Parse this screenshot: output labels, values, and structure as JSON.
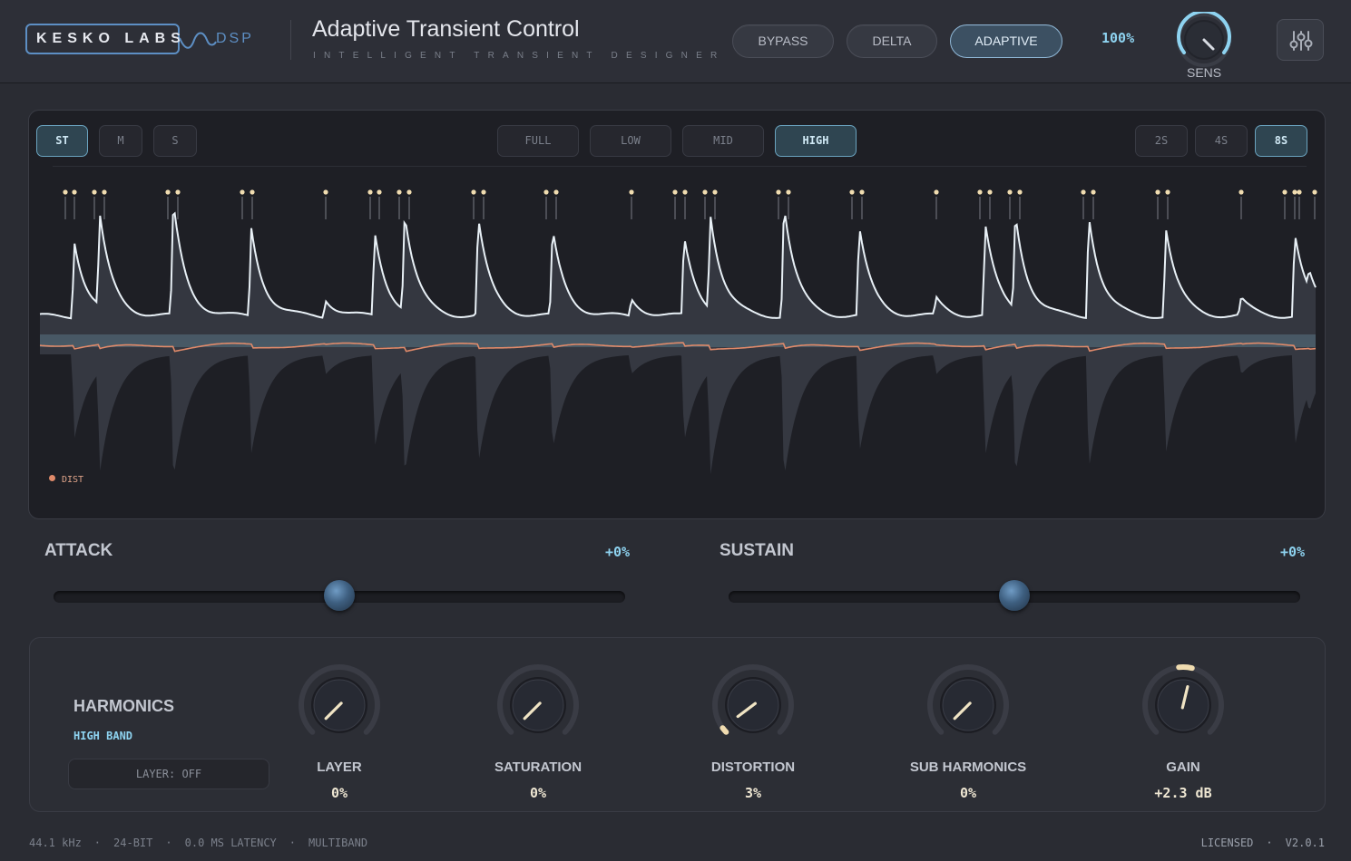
{
  "header": {
    "logo_text": "KESKO LABS",
    "logo_suffix": "DSP",
    "title": "Adaptive Transient Control",
    "subtitle": "INTELLIGENT TRANSIENT DESIGNER",
    "modes": [
      {
        "label": "BYPASS",
        "active": false
      },
      {
        "label": "DELTA",
        "active": false
      },
      {
        "label": "ADAPTIVE",
        "active": true
      }
    ],
    "mix_value": "100%",
    "sens_label": "SENS",
    "settings_icon": "sliders-icon"
  },
  "scope": {
    "channel_buttons": [
      {
        "label": "ST",
        "active": true
      },
      {
        "label": "M",
        "active": false
      },
      {
        "label": "S",
        "active": false
      }
    ],
    "band_buttons": [
      {
        "label": "FULL",
        "active": false
      },
      {
        "label": "LOW",
        "active": false
      },
      {
        "label": "MID",
        "active": false
      },
      {
        "label": "HIGH",
        "active": true
      }
    ],
    "time_buttons": [
      {
        "label": "2S",
        "active": false
      },
      {
        "label": "4S",
        "active": false
      },
      {
        "label": "8S",
        "active": true
      }
    ],
    "legend": "DIST",
    "colors": {
      "envelope": "#e8f0f6",
      "dist": "#e08a6a",
      "marker": "#f0dcb0"
    }
  },
  "attack": {
    "label": "ATTACK",
    "value": "+0%",
    "position": 0.5
  },
  "sustain": {
    "label": "SUSTAIN",
    "value": "+0%",
    "position": 0.5
  },
  "harmonics": {
    "title": "HARMONICS",
    "band": "HIGH BAND",
    "layer_button": "LAYER: OFF",
    "knobs": [
      {
        "label": "LAYER",
        "value": "0%",
        "level": 0
      },
      {
        "label": "SATURATION",
        "value": "0%",
        "level": 0
      },
      {
        "label": "DISTORTION",
        "value": "3%",
        "level": 0.03
      },
      {
        "label": "SUB HARMONICS",
        "value": "0%",
        "level": 0
      },
      {
        "label": "GAIN",
        "value": "+2.3 dB",
        "level": 0.55
      }
    ]
  },
  "footer": {
    "sample_rate": "44.1 kHz",
    "bit_depth": "24-BIT",
    "latency": "0.0 MS LATENCY",
    "mode": "MULTIBAND",
    "license": "LICENSED",
    "version": "V2.0.1"
  }
}
